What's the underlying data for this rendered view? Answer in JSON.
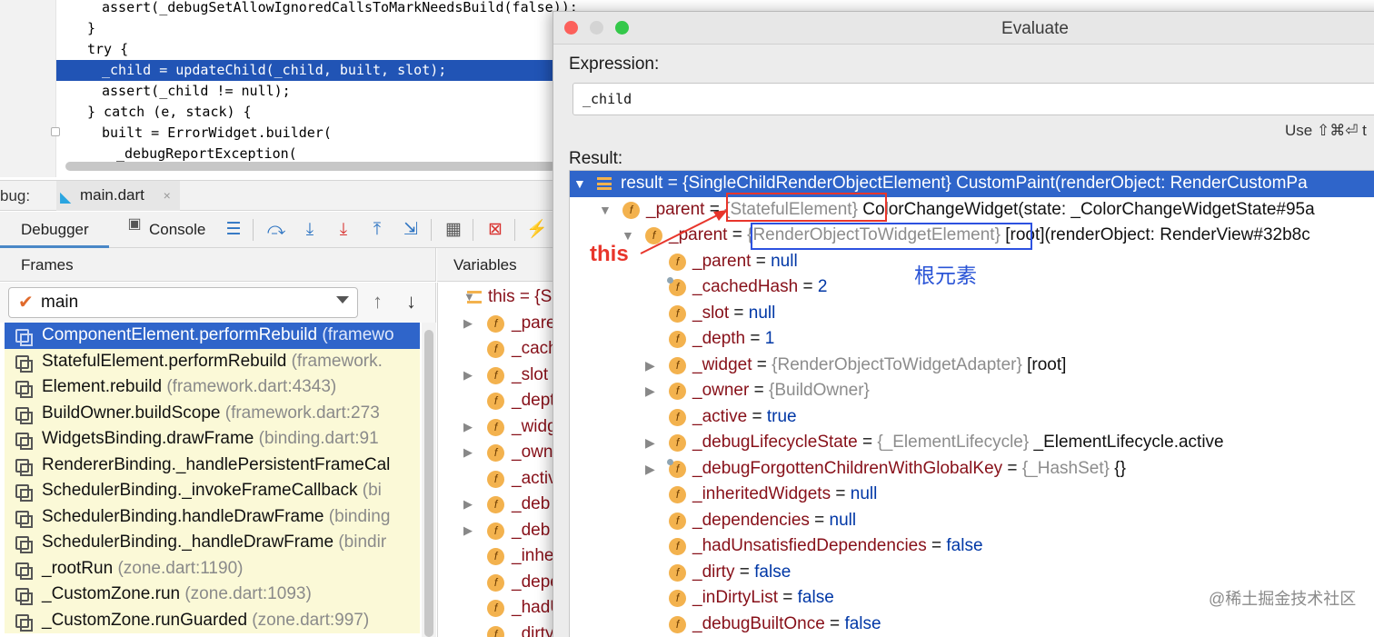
{
  "editor": {
    "lines": [
      {
        "text": "assert(_debugSetAllowIgnoredCallsToMarkNeedsBuild(false));",
        "indent": 2
      },
      {
        "text": "}",
        "indent": 1
      },
      {
        "text": "try {",
        "indent": 1
      },
      {
        "text": "_child = updateChild(_child, built, slot);",
        "indent": 2,
        "highlighted": true
      },
      {
        "text": "assert(_child != null);",
        "indent": 2
      },
      {
        "text": "} catch (e, stack) {",
        "indent": 1
      },
      {
        "text": "built = ErrorWidget.builder(",
        "indent": 2
      },
      {
        "text": "_debugReportException(",
        "indent": 3
      }
    ]
  },
  "debug_tabbar": {
    "label": "bug:",
    "file_tab": "main.dart",
    "close": "×"
  },
  "toolbar": {
    "debugger_tab": "Debugger",
    "console_tab": "Console",
    "icons": [
      "console-icon",
      "menu-icon",
      "step-over-icon",
      "step-into-icon",
      "force-step-into-icon",
      "step-out-icon",
      "run-to-cursor-icon",
      "evaluate-icon",
      "drop-frame-icon",
      "flash-icon"
    ]
  },
  "frames": {
    "header": "Frames",
    "thread": "main",
    "rows": [
      {
        "method": "ComponentElement.performRebuild",
        "loc": "(framewo",
        "selected": true
      },
      {
        "method": "StatefulElement.performRebuild",
        "loc": "(framework."
      },
      {
        "method": "Element.rebuild",
        "loc": "(framework.dart:4343)"
      },
      {
        "method": "BuildOwner.buildScope",
        "loc": "(framework.dart:273"
      },
      {
        "method": "WidgetsBinding.drawFrame",
        "loc": "(binding.dart:91"
      },
      {
        "method": "RendererBinding._handlePersistentFrameCal",
        "loc": ""
      },
      {
        "method": "SchedulerBinding._invokeFrameCallback",
        "loc": "(bi"
      },
      {
        "method": "SchedulerBinding.handleDrawFrame",
        "loc": "(binding"
      },
      {
        "method": "SchedulerBinding._handleDrawFrame",
        "loc": "(bindir"
      },
      {
        "method": "_rootRun",
        "loc": "(zone.dart:1190)"
      },
      {
        "method": "_CustomZone.run",
        "loc": "(zone.dart:1093)"
      },
      {
        "method": "_CustomZone.runGuarded",
        "loc": "(zone.dart:997)"
      }
    ]
  },
  "variables": {
    "header": "Variables",
    "rows": [
      {
        "name": "this = {S",
        "expand": "▼",
        "icon": "list"
      },
      {
        "name": "_pare",
        "expand": "▶"
      },
      {
        "name": "_cach",
        "expand": ""
      },
      {
        "name": "_slot",
        "expand": "▶"
      },
      {
        "name": "_dept",
        "expand": ""
      },
      {
        "name": "_widg",
        "expand": "▶"
      },
      {
        "name": "_own",
        "expand": "▶"
      },
      {
        "name": "_activ",
        "expand": ""
      },
      {
        "name": "_deb",
        "expand": "▶"
      },
      {
        "name": "_deb",
        "expand": "▶"
      },
      {
        "name": "_inhe",
        "expand": ""
      },
      {
        "name": "_depe",
        "expand": ""
      },
      {
        "name": "_hadU",
        "expand": ""
      },
      {
        "name": "_dirty",
        "expand": ""
      }
    ]
  },
  "dialog": {
    "title": "Evaluate",
    "expression_label": "Expression:",
    "expression_value": "_child",
    "use_hint": "Use ⇧⌘⏎ t",
    "result_label": "Result:",
    "colors": {
      "close": "#fc605b",
      "min": "#d4d4d4",
      "max": "#34c84a"
    },
    "rows": [
      {
        "level": 0,
        "expand": "▼",
        "icon": "list",
        "name": "result",
        "eq": " = ",
        "type": "{SingleChildRenderObjectElement}",
        "value": " CustomPaint(renderObject: RenderCustomPa",
        "selected": true
      },
      {
        "level": 1,
        "expand": "▼",
        "icon": "f",
        "name": "_parent",
        "eq": " = ",
        "type": "{StatefulElement}",
        "value": " ColorChangeWidget(state: _ColorChangeWidgetState#95a"
      },
      {
        "level": 2,
        "expand": "▼",
        "icon": "f",
        "name": "_parent",
        "eq": " = ",
        "type": "{RenderObjectToWidgetElement}",
        "value": " [root](renderObject: RenderView#32b8c"
      },
      {
        "level": 3,
        "expand": "",
        "icon": "f",
        "name": "_parent",
        "eq": " = ",
        "literal": "null"
      },
      {
        "level": 3,
        "expand": "",
        "icon": "fpin",
        "name": "_cachedHash",
        "eq": " = ",
        "literal": "2"
      },
      {
        "level": 3,
        "expand": "",
        "icon": "f",
        "name": "_slot",
        "eq": " = ",
        "literal": "null"
      },
      {
        "level": 3,
        "expand": "",
        "icon": "f",
        "name": "_depth",
        "eq": " = ",
        "literal": "1"
      },
      {
        "level": 3,
        "expand": "▶",
        "icon": "f",
        "name": "_widget",
        "eq": " = ",
        "type": "{RenderObjectToWidgetAdapter}",
        "value": " [root]"
      },
      {
        "level": 3,
        "expand": "▶",
        "icon": "f",
        "name": "_owner",
        "eq": " = ",
        "type": "{BuildOwner}",
        "value": ""
      },
      {
        "level": 3,
        "expand": "",
        "icon": "f",
        "name": "_active",
        "eq": " = ",
        "literal": "true"
      },
      {
        "level": 3,
        "expand": "▶",
        "icon": "f",
        "name": "_debugLifecycleState",
        "eq": " = ",
        "type": "{_ElementLifecycle}",
        "value": " _ElementLifecycle.active"
      },
      {
        "level": 3,
        "expand": "▶",
        "icon": "fpin",
        "name": "_debugForgottenChildrenWithGlobalKey",
        "eq": " = ",
        "type": "{_HashSet}",
        "value": " {}"
      },
      {
        "level": 3,
        "expand": "",
        "icon": "f",
        "name": "_inheritedWidgets",
        "eq": " = ",
        "literal": "null"
      },
      {
        "level": 3,
        "expand": "",
        "icon": "f",
        "name": "_dependencies",
        "eq": " = ",
        "literal": "null"
      },
      {
        "level": 3,
        "expand": "",
        "icon": "f",
        "name": "_hadUnsatisfiedDependencies",
        "eq": " = ",
        "literal": "false"
      },
      {
        "level": 3,
        "expand": "",
        "icon": "f",
        "name": "_dirty",
        "eq": " = ",
        "literal": "false"
      },
      {
        "level": 3,
        "expand": "",
        "icon": "f",
        "name": "_inDirtyList",
        "eq": " = ",
        "literal": "false"
      },
      {
        "level": 3,
        "expand": "",
        "icon": "f",
        "name": "_debugBuiltOnce",
        "eq": " = ",
        "literal": "false"
      }
    ],
    "annotation_this": "this",
    "annotation_root": "根元素"
  },
  "watermark": "@稀土掘金技术社区"
}
